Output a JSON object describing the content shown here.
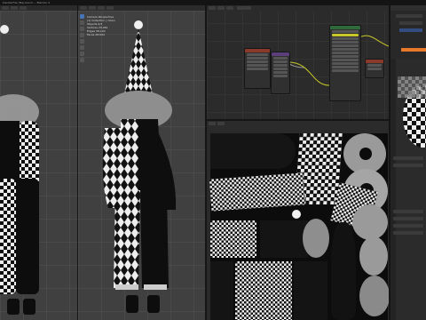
{
  "app": {
    "window_title": "blenderFile (file).blend — Blender 4",
    "active_tab": "UV Editing"
  },
  "header": {
    "menus": [
      "File",
      "Edit",
      "Render",
      "Window",
      "Help"
    ]
  },
  "viewport_left": {
    "label": "User Perspective",
    "info_lines": [
      "(1) Collection | clown",
      "Objects 0/3",
      "Vertices 29,481",
      "Edges 58,120",
      "Faces 28,644",
      "Triangles 57,106"
    ]
  },
  "viewport_mid": {
    "label": "Camera Perspective",
    "info_lines": [
      "(1) Collection | clown",
      "Objects 0/3",
      "Vertices 29,481",
      "Edges 58,120",
      "Faces 28,644"
    ]
  },
  "node_editor": {
    "nodes": [
      "Image Texture",
      "Mapping",
      "Principled BSDF",
      "Material Output"
    ]
  },
  "properties": {
    "tabs": [
      "Scene",
      "Object",
      "Material"
    ]
  },
  "colors": {
    "accent_orange": "#e8782a",
    "node_shader_green": "#2f6b3a",
    "node_texture_red": "#8a3a2a",
    "node_vector_purple": "#5a3f7a",
    "socket_yellow": "#c7c729",
    "socket_grey": "#a1a1a1"
  }
}
